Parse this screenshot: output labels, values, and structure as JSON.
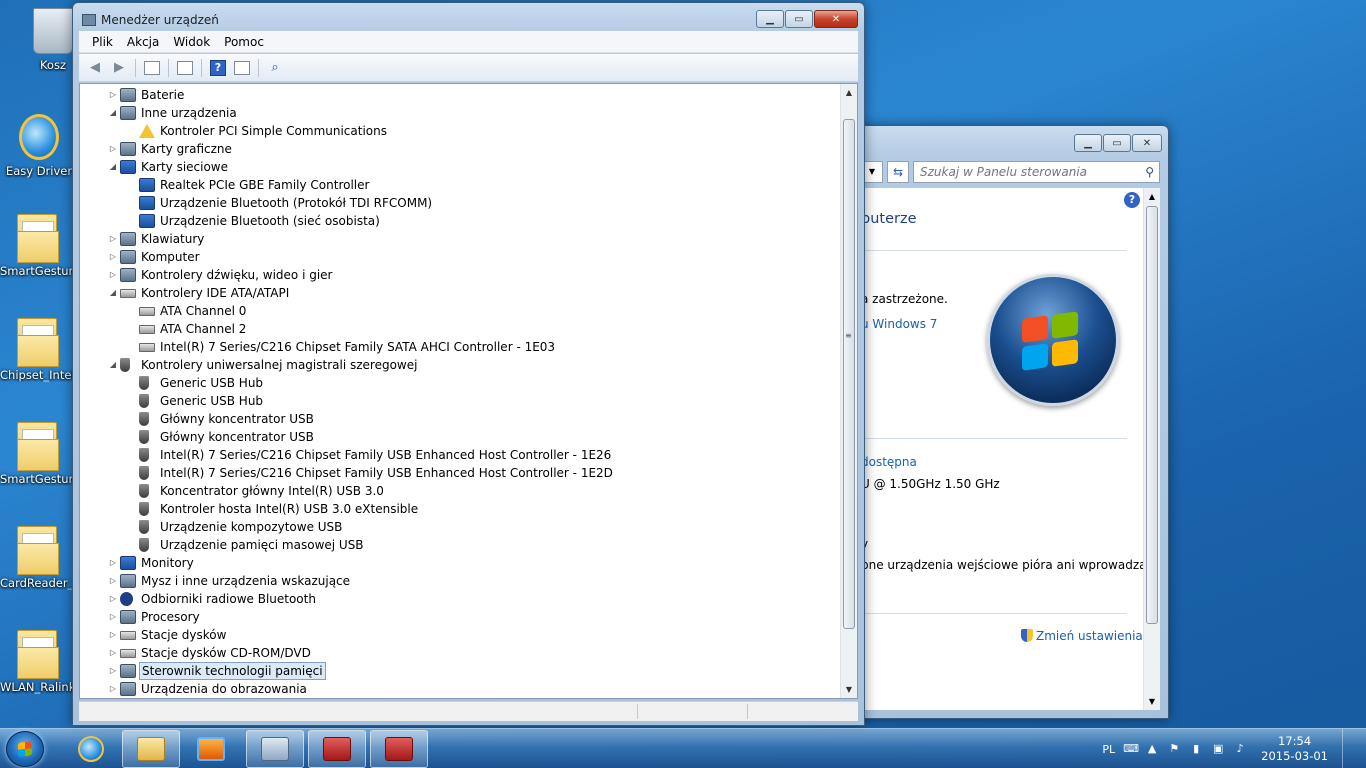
{
  "desktop": {
    "icons": [
      {
        "label": "Kosz",
        "type": "bin"
      },
      {
        "label": "Easy Driver",
        "type": "ie"
      },
      {
        "label": "SmartGesture",
        "type": "folder"
      },
      {
        "label": "Chipset_Intel",
        "type": "folder"
      },
      {
        "label": "SmartGesture",
        "type": "folder"
      },
      {
        "label": "CardReader_R",
        "type": "folder"
      },
      {
        "label": "WLAN_Ralink",
        "type": "folder"
      }
    ]
  },
  "devmgr": {
    "title": "Menedżer urządzeń",
    "menu": [
      "Plik",
      "Akcja",
      "Widok",
      "Pomoc"
    ],
    "toolbar_icons": [
      "back-icon",
      "forward-icon",
      "show-hide-tree-icon",
      "properties-icon",
      "help-icon",
      "run-icon",
      "scan-hardware-icon"
    ],
    "tree": [
      {
        "label": "Baterie",
        "level": 0,
        "expanded": false,
        "icon": "cat"
      },
      {
        "label": "Inne urządzenia",
        "level": 0,
        "expanded": true,
        "icon": "cat"
      },
      {
        "label": "Kontroler PCI Simple Communications",
        "level": 1,
        "icon": "warn"
      },
      {
        "label": "Karty graficzne",
        "level": 0,
        "expanded": false,
        "icon": "cat"
      },
      {
        "label": "Karty sieciowe",
        "level": 0,
        "expanded": true,
        "icon": "net"
      },
      {
        "label": "Realtek PCIe GBE Family Controller",
        "level": 1,
        "icon": "net"
      },
      {
        "label": "Urządzenie Bluetooth (Protokół TDI RFCOMM)",
        "level": 1,
        "icon": "net"
      },
      {
        "label": "Urządzenie Bluetooth (sieć osobista)",
        "level": 1,
        "icon": "net"
      },
      {
        "label": "Klawiatury",
        "level": 0,
        "expanded": false,
        "icon": "cat"
      },
      {
        "label": "Komputer",
        "level": 0,
        "expanded": false,
        "icon": "cat"
      },
      {
        "label": "Kontrolery dźwięku, wideo i gier",
        "level": 0,
        "expanded": false,
        "icon": "cat"
      },
      {
        "label": "Kontrolery IDE ATA/ATAPI",
        "level": 0,
        "expanded": true,
        "icon": "ide"
      },
      {
        "label": "ATA Channel 0",
        "level": 1,
        "icon": "ide"
      },
      {
        "label": "ATA Channel 2",
        "level": 1,
        "icon": "ide"
      },
      {
        "label": "Intel(R) 7 Series/C216 Chipset Family SATA AHCI Controller - 1E03",
        "level": 1,
        "icon": "ide"
      },
      {
        "label": "Kontrolery uniwersalnej magistrali szeregowej",
        "level": 0,
        "expanded": true,
        "icon": "usb"
      },
      {
        "label": "Generic USB Hub",
        "level": 1,
        "icon": "usb"
      },
      {
        "label": "Generic USB Hub",
        "level": 1,
        "icon": "usb"
      },
      {
        "label": "Główny koncentrator USB",
        "level": 1,
        "icon": "usb"
      },
      {
        "label": "Główny koncentrator USB",
        "level": 1,
        "icon": "usb"
      },
      {
        "label": "Intel(R) 7 Series/C216 Chipset Family USB Enhanced Host Controller - 1E26",
        "level": 1,
        "icon": "usb"
      },
      {
        "label": "Intel(R) 7 Series/C216 Chipset Family USB Enhanced Host Controller - 1E2D",
        "level": 1,
        "icon": "usb"
      },
      {
        "label": "Koncentrator główny Intel(R) USB 3.0",
        "level": 1,
        "icon": "usb"
      },
      {
        "label": "Kontroler hosta Intel(R) USB 3.0 eXtensible",
        "level": 1,
        "icon": "usb"
      },
      {
        "label": "Urządzenie kompozytowe USB",
        "level": 1,
        "icon": "usb"
      },
      {
        "label": "Urządzenie pamięci masowej USB",
        "level": 1,
        "icon": "usb"
      },
      {
        "label": "Monitory",
        "level": 0,
        "expanded": false,
        "icon": "net"
      },
      {
        "label": "Mysz i inne urządzenia wskazujące",
        "level": 0,
        "expanded": false,
        "icon": "cat"
      },
      {
        "label": "Odbiorniki radiowe Bluetooth",
        "level": 0,
        "expanded": false,
        "icon": "bt"
      },
      {
        "label": "Procesory",
        "level": 0,
        "expanded": false,
        "icon": "cat"
      },
      {
        "label": "Stacje dysków",
        "level": 0,
        "expanded": false,
        "icon": "ide"
      },
      {
        "label": "Stacje dysków CD-ROM/DVD",
        "level": 0,
        "expanded": false,
        "icon": "ide"
      },
      {
        "label": "Sterownik technologii pamięci",
        "level": 0,
        "expanded": false,
        "icon": "cat",
        "selected": true
      },
      {
        "label": "Urządzenia do obrazowania",
        "level": 0,
        "expanded": false,
        "icon": "cat"
      }
    ]
  },
  "ctrlpanel": {
    "search_placeholder": "Szukaj w Panelu sterowania",
    "heading_fragment": "puterze",
    "copyright_fragment": "a zastrzeżone.",
    "upgrade_link": "u Windows 7",
    "rating_link": "dostępna",
    "cpu_fragment": "U @ 1.50GHz   1.50 GHz",
    "y_fragment": "y",
    "pen_fragment": "pne urządzenia wejściowe pióra ani wprowadzania",
    "change_settings": "Zmień ustawienia"
  },
  "taskbar": {
    "items": [
      {
        "name": "ie",
        "state": "pinned"
      },
      {
        "name": "explorer",
        "state": "open"
      },
      {
        "name": "media",
        "state": "pinned"
      },
      {
        "name": "devmgr",
        "state": "open"
      },
      {
        "name": "tool1",
        "state": "open"
      },
      {
        "name": "tool2",
        "state": "open"
      }
    ],
    "lang": "PL",
    "time": "17:54",
    "date": "2015-03-01"
  },
  "colors": {
    "link": "#1a5fb4",
    "selection": "#dceaf8",
    "desktop": "#2b86d1"
  }
}
